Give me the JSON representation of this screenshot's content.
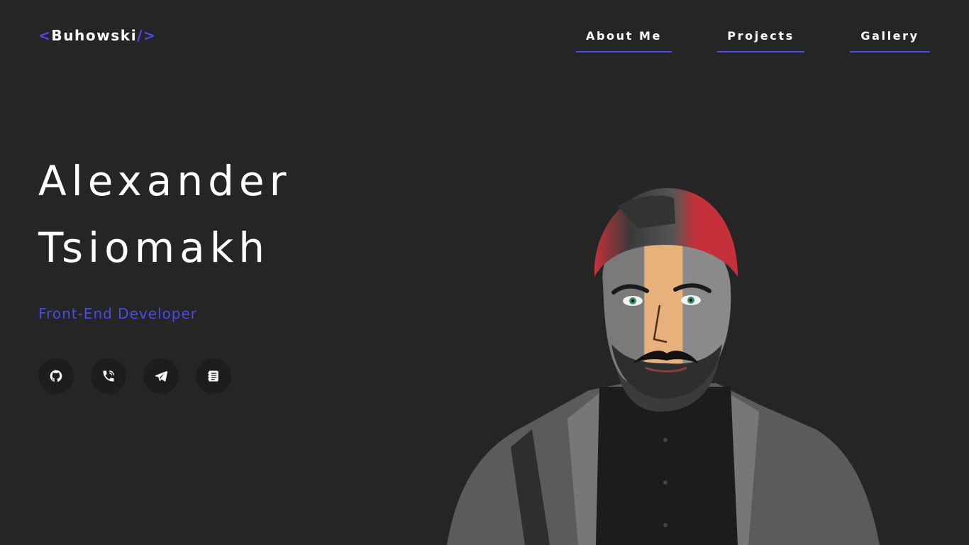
{
  "header": {
    "logo": {
      "open_bracket": "<",
      "name": "Buhowski",
      "close_bracket": "/>"
    },
    "nav": [
      {
        "label": "About Me"
      },
      {
        "label": "Projects"
      },
      {
        "label": "Gallery"
      }
    ]
  },
  "hero": {
    "first_name": "Alexander",
    "last_name": "Tsiomakh",
    "role": "Front-End Developer"
  },
  "socials": [
    {
      "icon": "github-icon"
    },
    {
      "icon": "phone-icon"
    },
    {
      "icon": "telegram-icon"
    },
    {
      "icon": "resume-icon"
    }
  ],
  "colors": {
    "background": "#252525",
    "accent": "#4a4ae6",
    "icon_circle": "#1d1d1d",
    "text": "#ffffff"
  }
}
